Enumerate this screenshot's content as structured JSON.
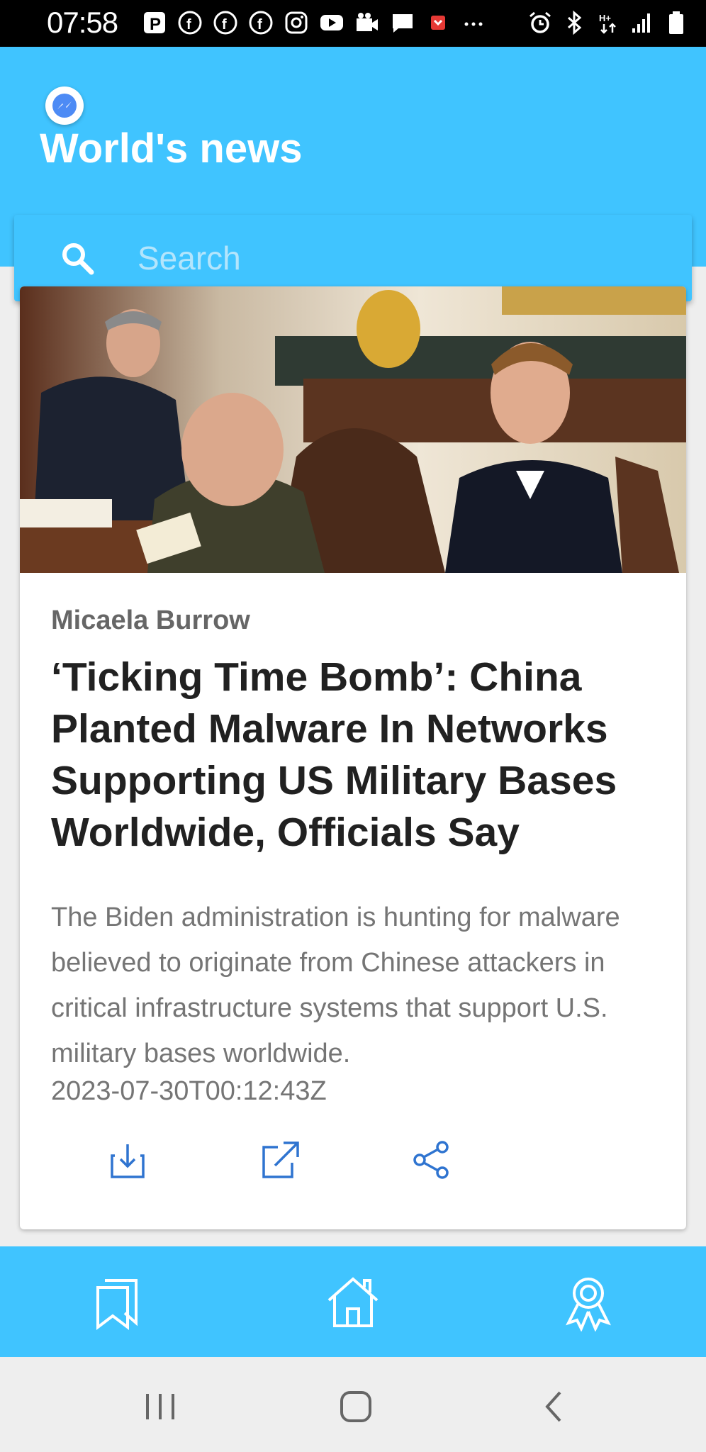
{
  "status_bar": {
    "time": "07:58",
    "icons_left": [
      "p-app-icon",
      "facebook-icon",
      "facebook-icon",
      "facebook-icon",
      "instagram-icon",
      "youtube-icon",
      "video-icon",
      "chat-icon",
      "pocket-icon",
      "more-dots-icon"
    ],
    "icons_right": [
      "alarm-icon",
      "bluetooth-icon",
      "data-arrows-icon",
      "signal-icon",
      "battery-icon"
    ]
  },
  "app": {
    "title": "World's news",
    "accent_color": "#40c4ff"
  },
  "search": {
    "placeholder": "Search"
  },
  "article": {
    "image": "news-photo-officials-at-table",
    "author": "Micaela Burrow",
    "headline": "‘Ticking Time Bomb’: China Planted Malware In Networks Supporting US Military Bases Worldwide, Officials Say",
    "summary": "The Biden administration is hunting for malware believed to originate from Chinese attackers in critical infrastructure systems that support U.S. military bases worldwide.",
    "published": "2023-07-30T00:12:43Z",
    "actions": [
      "download-icon",
      "open-external-icon",
      "share-icon"
    ]
  },
  "bottom_nav": {
    "items": [
      "bookmarks-icon",
      "home-icon",
      "award-icon"
    ]
  },
  "system_nav": {
    "items": [
      "recents-icon",
      "home-circle-icon",
      "back-icon"
    ]
  }
}
